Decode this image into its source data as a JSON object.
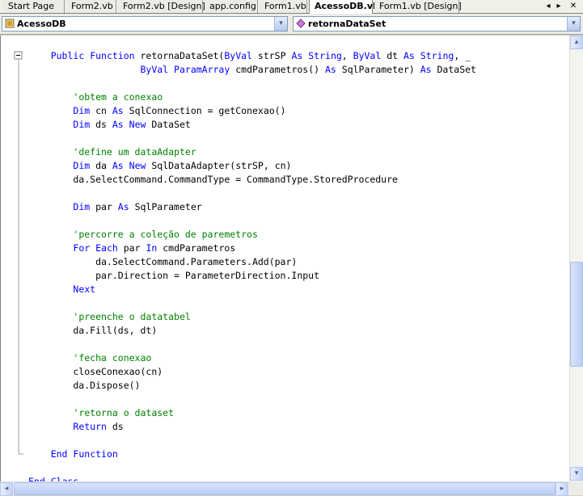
{
  "tabs": [
    {
      "label": "Start Page",
      "active": false
    },
    {
      "label": "Form2.vb",
      "active": false
    },
    {
      "label": "Form2.vb [Design]",
      "active": false
    },
    {
      "label": "app.config",
      "active": false
    },
    {
      "label": "Form1.vb",
      "active": false
    },
    {
      "label": "AcessoDB.vb",
      "active": true
    },
    {
      "label": "Form1.vb [Design]",
      "active": false
    }
  ],
  "tab_controls": {
    "prev": "◂",
    "next": "▸",
    "close": "✕"
  },
  "class_combo": {
    "value": "AcessoDB",
    "icon": "class-icon"
  },
  "member_combo": {
    "value": "retornaDataSet",
    "icon": "method-icon"
  },
  "combo_arrow": "▾",
  "scroll_arrows": {
    "up": "▴",
    "down": "▾",
    "left": "◂",
    "right": "▸"
  },
  "outline_markers": {
    "collapse": "−",
    "end": "−"
  },
  "code_lines": [
    {
      "parts": []
    },
    {
      "parts": [
        {
          "t": "    "
        },
        {
          "t": "Public",
          "k": "kw"
        },
        {
          "t": " "
        },
        {
          "t": "Function",
          "k": "kw"
        },
        {
          "t": " retornaDataSet("
        },
        {
          "t": "ByVal",
          "k": "kw"
        },
        {
          "t": " strSP "
        },
        {
          "t": "As",
          "k": "kw"
        },
        {
          "t": " "
        },
        {
          "t": "String",
          "k": "kw"
        },
        {
          "t": ", "
        },
        {
          "t": "ByVal",
          "k": "kw"
        },
        {
          "t": " dt "
        },
        {
          "t": "As",
          "k": "kw"
        },
        {
          "t": " "
        },
        {
          "t": "String",
          "k": "kw"
        },
        {
          "t": ", _"
        }
      ]
    },
    {
      "parts": [
        {
          "t": "                    "
        },
        {
          "t": "ByVal",
          "k": "kw"
        },
        {
          "t": " "
        },
        {
          "t": "ParamArray",
          "k": "kw"
        },
        {
          "t": " cmdParametros() "
        },
        {
          "t": "As",
          "k": "kw"
        },
        {
          "t": " SqlParameter) "
        },
        {
          "t": "As",
          "k": "kw"
        },
        {
          "t": " DataSet"
        }
      ]
    },
    {
      "parts": []
    },
    {
      "parts": [
        {
          "t": "        "
        },
        {
          "t": "'obtem a conexao",
          "k": "cm"
        }
      ]
    },
    {
      "parts": [
        {
          "t": "        "
        },
        {
          "t": "Dim",
          "k": "kw"
        },
        {
          "t": " cn "
        },
        {
          "t": "As",
          "k": "kw"
        },
        {
          "t": " SqlConnection = getConexao()"
        }
      ]
    },
    {
      "parts": [
        {
          "t": "        "
        },
        {
          "t": "Dim",
          "k": "kw"
        },
        {
          "t": " ds "
        },
        {
          "t": "As",
          "k": "kw"
        },
        {
          "t": " "
        },
        {
          "t": "New",
          "k": "kw"
        },
        {
          "t": " DataSet"
        }
      ]
    },
    {
      "parts": []
    },
    {
      "parts": [
        {
          "t": "        "
        },
        {
          "t": "'define um dataAdapter",
          "k": "cm"
        }
      ]
    },
    {
      "parts": [
        {
          "t": "        "
        },
        {
          "t": "Dim",
          "k": "kw"
        },
        {
          "t": " da "
        },
        {
          "t": "As",
          "k": "kw"
        },
        {
          "t": " "
        },
        {
          "t": "New",
          "k": "kw"
        },
        {
          "t": " SqlDataAdapter(strSP, cn)"
        }
      ]
    },
    {
      "parts": [
        {
          "t": "        da.SelectCommand.CommandType = CommandType.StoredProcedure"
        }
      ]
    },
    {
      "parts": []
    },
    {
      "parts": [
        {
          "t": "        "
        },
        {
          "t": "Dim",
          "k": "kw"
        },
        {
          "t": " par "
        },
        {
          "t": "As",
          "k": "kw"
        },
        {
          "t": " SqlParameter"
        }
      ]
    },
    {
      "parts": []
    },
    {
      "parts": [
        {
          "t": "        "
        },
        {
          "t": "'percorre a coleção de paremetros",
          "k": "cm"
        }
      ]
    },
    {
      "parts": [
        {
          "t": "        "
        },
        {
          "t": "For",
          "k": "kw"
        },
        {
          "t": " "
        },
        {
          "t": "Each",
          "k": "kw"
        },
        {
          "t": " par "
        },
        {
          "t": "In",
          "k": "kw"
        },
        {
          "t": " cmdParametros"
        }
      ]
    },
    {
      "parts": [
        {
          "t": "            da.SelectCommand.Parameters.Add(par)"
        }
      ]
    },
    {
      "parts": [
        {
          "t": "            par.Direction = ParameterDirection.Input"
        }
      ]
    },
    {
      "parts": [
        {
          "t": "        "
        },
        {
          "t": "Next",
          "k": "kw"
        }
      ]
    },
    {
      "parts": []
    },
    {
      "parts": [
        {
          "t": "        "
        },
        {
          "t": "'preenche o datatabel",
          "k": "cm"
        }
      ]
    },
    {
      "parts": [
        {
          "t": "        da.Fill(ds, dt)"
        }
      ]
    },
    {
      "parts": []
    },
    {
      "parts": [
        {
          "t": "        "
        },
        {
          "t": "'fecha conexao",
          "k": "cm"
        }
      ]
    },
    {
      "parts": [
        {
          "t": "        closeConexao(cn)"
        }
      ]
    },
    {
      "parts": [
        {
          "t": "        da.Dispose()"
        }
      ]
    },
    {
      "parts": []
    },
    {
      "parts": [
        {
          "t": "        "
        },
        {
          "t": "'retorna o dataset",
          "k": "cm"
        }
      ]
    },
    {
      "parts": [
        {
          "t": "        "
        },
        {
          "t": "Return",
          "k": "kw"
        },
        {
          "t": " ds"
        }
      ]
    },
    {
      "parts": []
    },
    {
      "parts": [
        {
          "t": "    "
        },
        {
          "t": "End",
          "k": "kw"
        },
        {
          "t": " "
        },
        {
          "t": "Function",
          "k": "kw"
        }
      ]
    },
    {
      "parts": []
    },
    {
      "parts": [
        {
          "t": "End",
          "k": "kw"
        },
        {
          "t": " "
        },
        {
          "t": "Class",
          "k": "kw"
        }
      ]
    }
  ],
  "colors": {
    "keyword": "#0000ff",
    "comment": "#008000",
    "text": "#000000"
  }
}
